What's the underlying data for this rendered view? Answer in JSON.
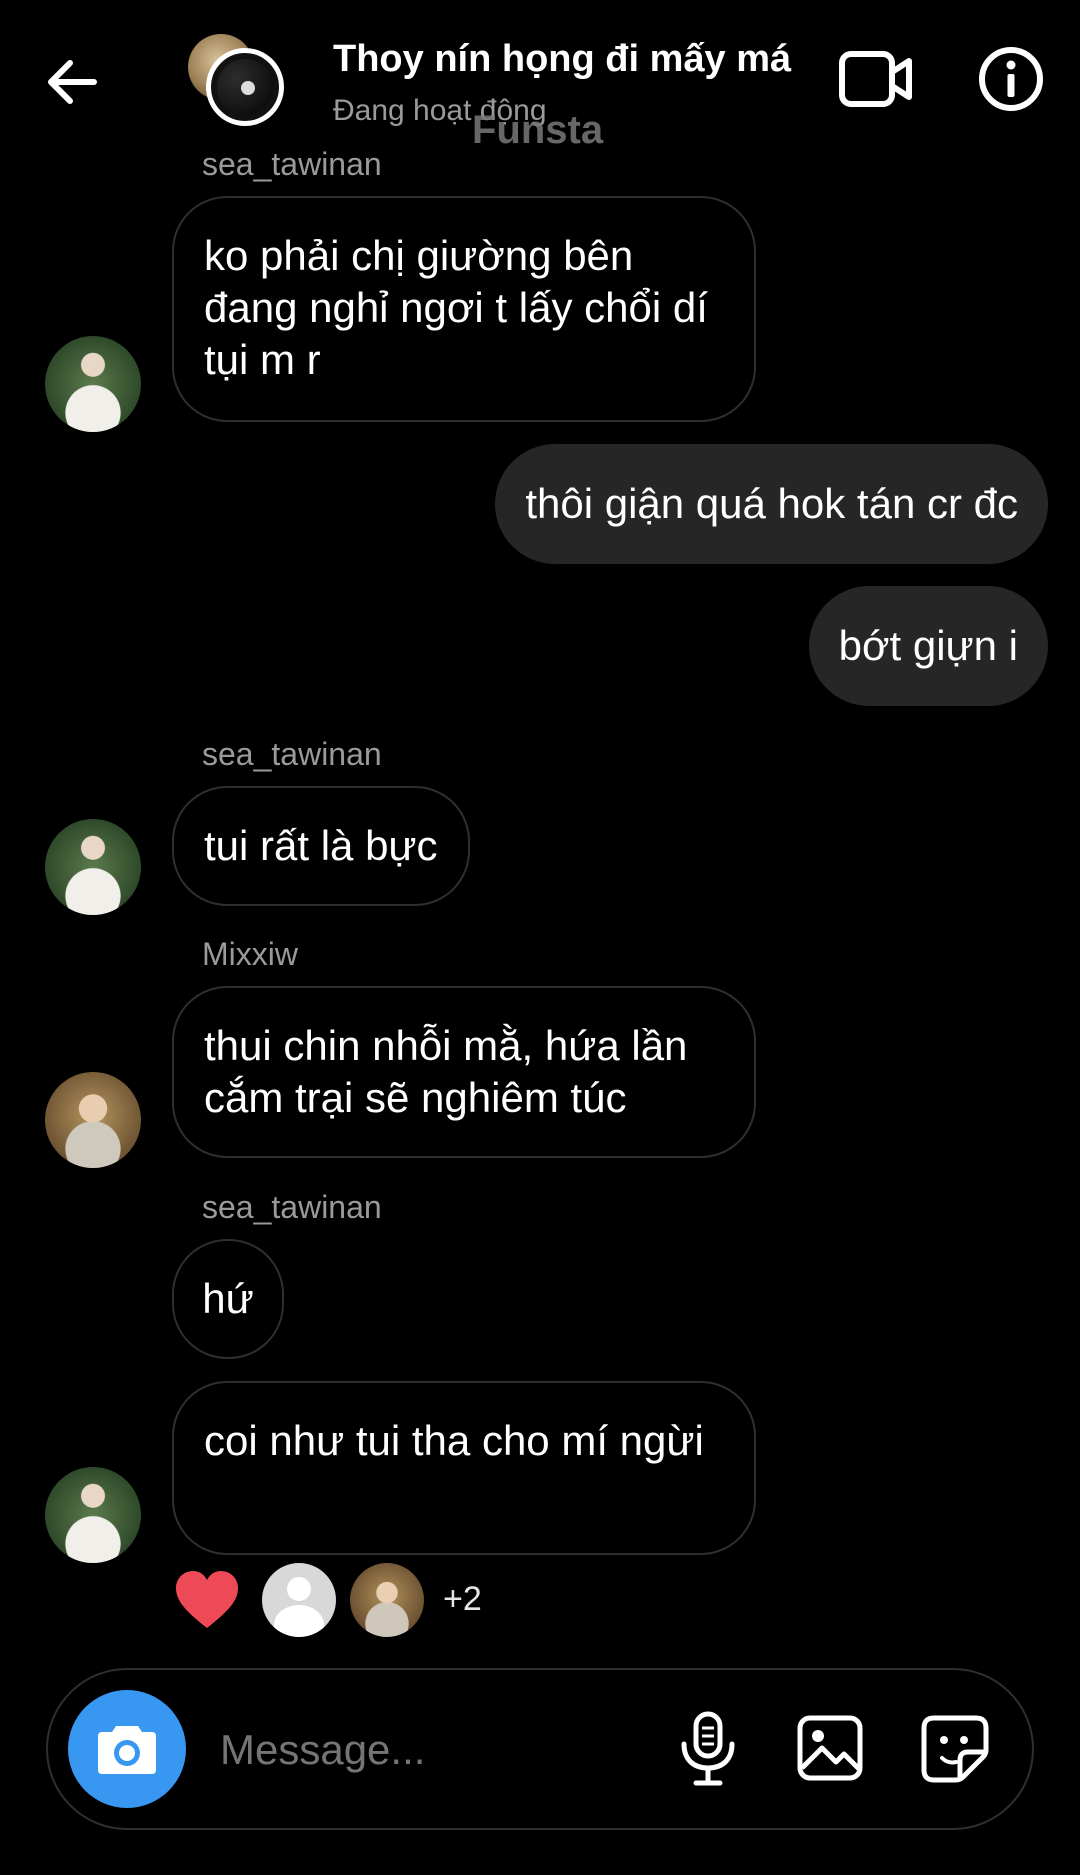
{
  "header": {
    "title": "Thoy nín họng đi mấy má",
    "status": "Đang hoạt động",
    "watermark": "Funsta"
  },
  "messages": [
    {
      "sender": "sea_tawinan",
      "text": "ko phải chị giường bên đang nghỉ ngơi t lấy chổi dí tụi m r",
      "direction": "incoming"
    },
    {
      "text": "thôi giận quá hok tán cr đc",
      "direction": "outgoing"
    },
    {
      "text": "bớt giựn i",
      "direction": "outgoing"
    },
    {
      "sender": "sea_tawinan",
      "text": "tui rất là bực",
      "direction": "incoming"
    },
    {
      "sender": "Mixxiw",
      "text": "thui chin nhỗi mằ, hứa lần cắm trại sẽ nghiêm túc",
      "direction": "incoming"
    },
    {
      "sender": "sea_tawinan",
      "text": "hứ",
      "direction": "incoming"
    },
    {
      "text": "coi như tui tha cho mí ngừi",
      "direction": "incoming"
    }
  ],
  "reactions": {
    "icon": "heart-icon",
    "color": "#ed4956",
    "extra_count": "+2"
  },
  "composer": {
    "placeholder": "Message..."
  },
  "colors": {
    "background": "#000000",
    "outgoing_bubble": "#262626",
    "camera_button": "#3897f0",
    "secondary_text": "#9a9a9a"
  }
}
